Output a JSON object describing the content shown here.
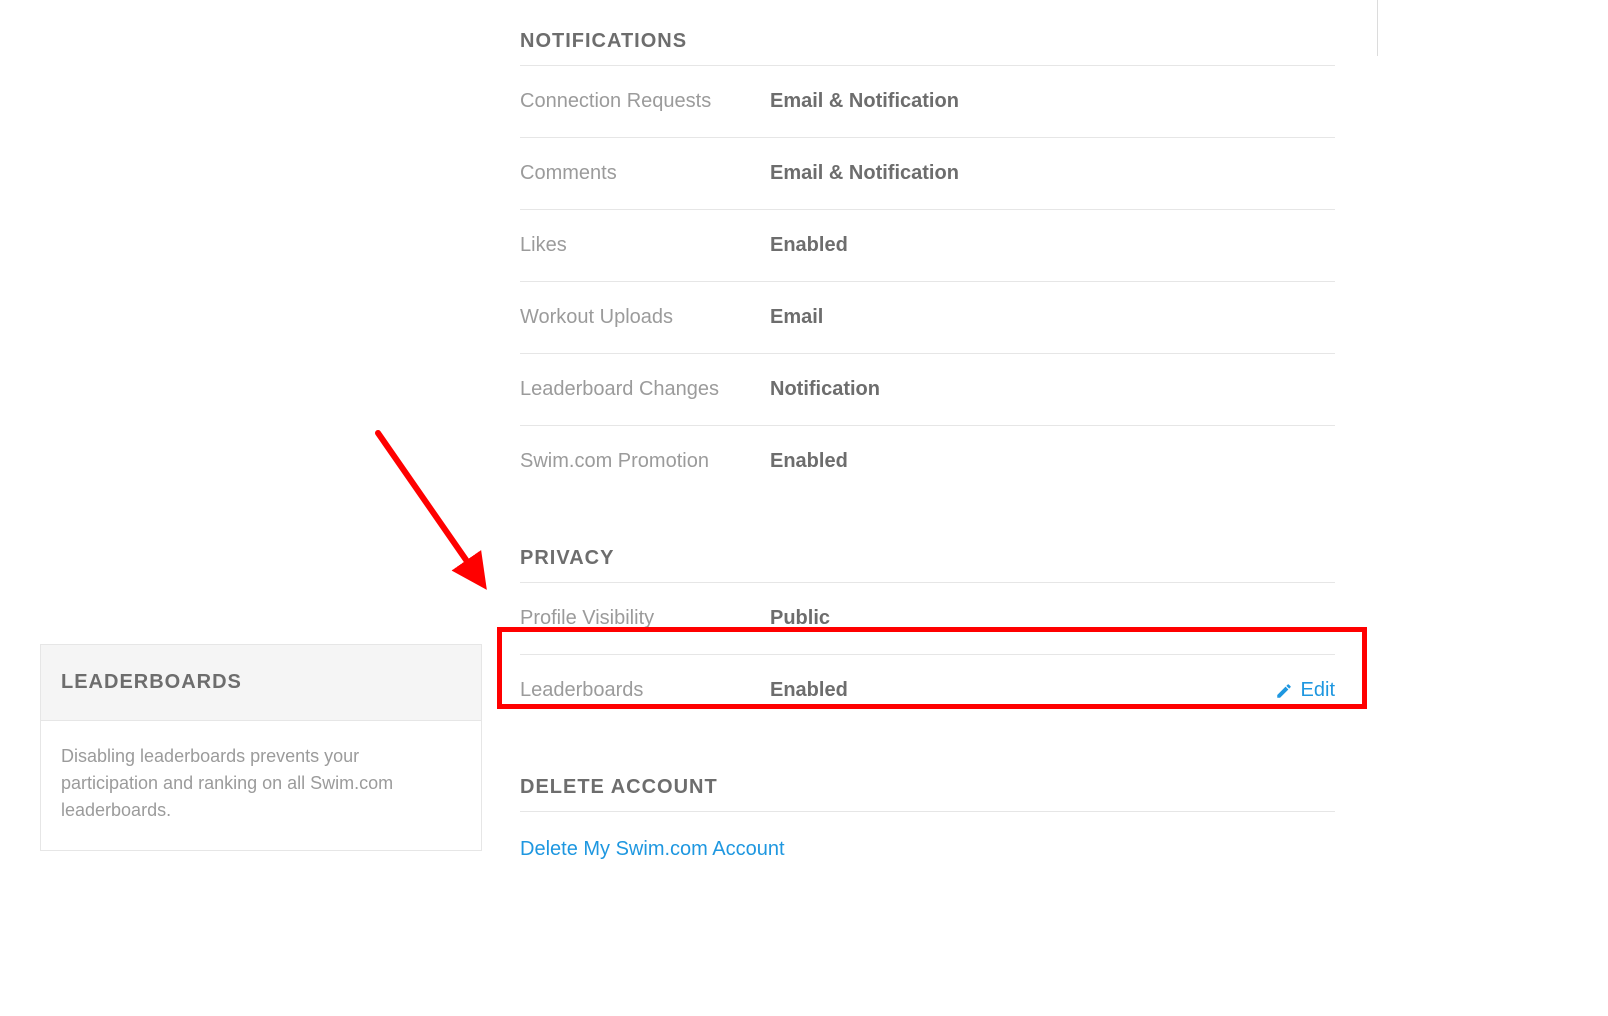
{
  "sections": {
    "notifications": {
      "title": "NOTIFICATIONS",
      "rows": [
        {
          "label": "Connection Requests",
          "value": "Email & Notification"
        },
        {
          "label": "Comments",
          "value": "Email & Notification"
        },
        {
          "label": "Likes",
          "value": "Enabled"
        },
        {
          "label": "Workout Uploads",
          "value": "Email"
        },
        {
          "label": "Leaderboard Changes",
          "value": "Notification"
        },
        {
          "label": "Swim.com Promotion",
          "value": "Enabled"
        }
      ]
    },
    "privacy": {
      "title": "PRIVACY",
      "rows": [
        {
          "label": "Profile Visibility",
          "value": "Public"
        },
        {
          "label": "Leaderboards",
          "value": "Enabled",
          "edit": "Edit"
        }
      ]
    },
    "delete": {
      "title": "DELETE ACCOUNT",
      "link": "Delete My Swim.com Account"
    }
  },
  "sidebar": {
    "title": "LEADERBOARDS",
    "body": "Disabling leaderboards prevents your participation and ranking on all Swim.com leaderboards."
  },
  "colors": {
    "link": "#1e97e0",
    "annotation": "#ff0000"
  }
}
